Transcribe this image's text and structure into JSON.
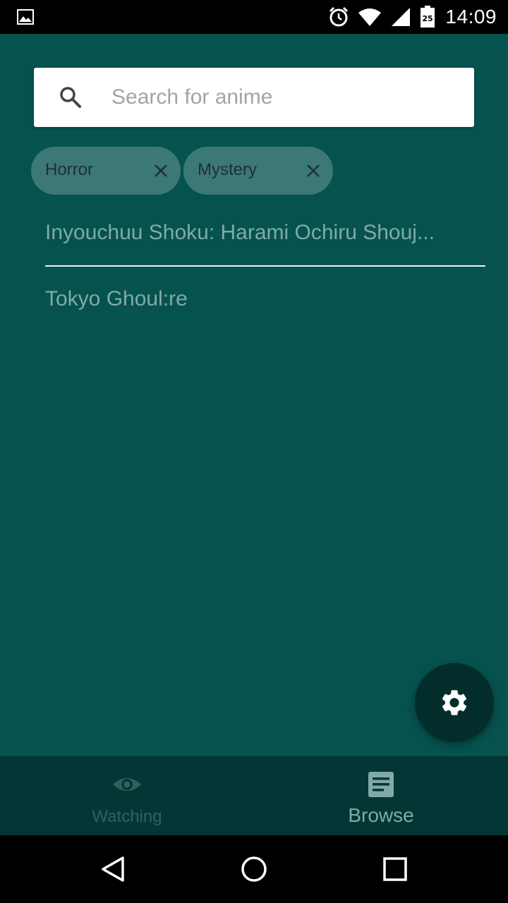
{
  "status_bar": {
    "time": "14:09",
    "battery_level": "25",
    "icons": [
      "gallery-icon",
      "alarm-icon",
      "wifi-icon",
      "cell-signal-icon",
      "battery-icon"
    ]
  },
  "search": {
    "placeholder": "Search for anime",
    "value": ""
  },
  "filters": [
    {
      "label": "Horror"
    },
    {
      "label": "Mystery"
    }
  ],
  "results": [
    {
      "title": "Inyouchuu Shoku: Harami Ochiru Shouj..."
    },
    {
      "title": "Tokyo Ghoul:re"
    }
  ],
  "fab": {
    "icon": "settings-icon"
  },
  "bottom_nav": {
    "items": [
      {
        "label": "Watching",
        "icon": "eye-icon",
        "active": false
      },
      {
        "label": "Browse",
        "icon": "document-icon",
        "active": true
      }
    ]
  },
  "system_nav": [
    "back-icon",
    "home-icon",
    "recents-icon"
  ],
  "colors": {
    "background": "#06524f",
    "bottom_nav": "#033635",
    "fab": "#032d2b",
    "chip": "#3c7875",
    "result_text": "#80aaa8"
  }
}
